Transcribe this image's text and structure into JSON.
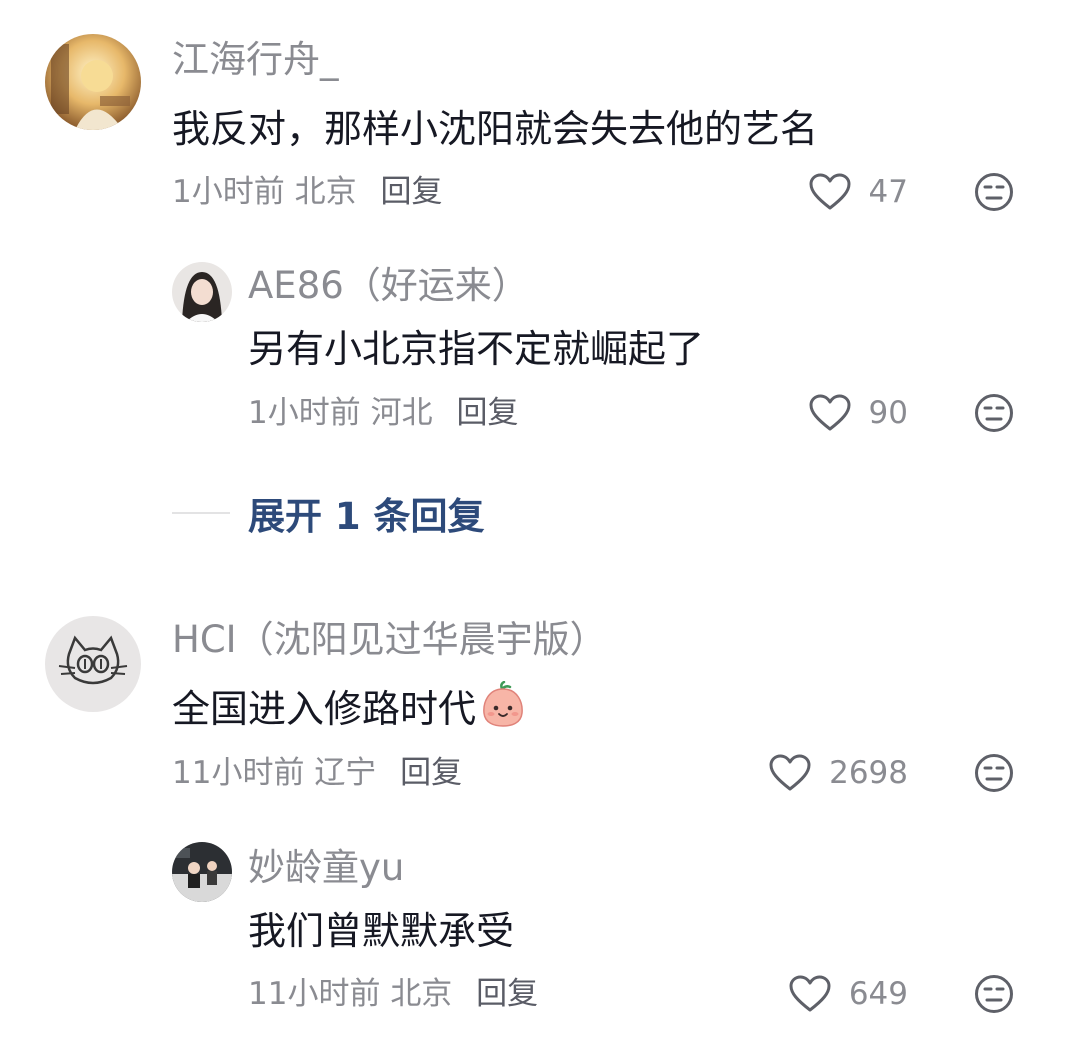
{
  "comments": [
    {
      "username": "江海行舟_",
      "text": "我反对，那样小沈阳就会失去他的艺名",
      "time": "1小时前",
      "location": "北京",
      "reply_label": "回复",
      "likes": "47",
      "replies": [
        {
          "username": "AE86（好运来）",
          "text": "另有小北京指不定就崛起了",
          "time": "1小时前",
          "location": "河北",
          "reply_label": "回复",
          "likes": "90"
        }
      ],
      "expand_label": "展开 1 条回复"
    },
    {
      "username": "HCI（沈阳见过华晨宇版）",
      "text": "全国进入修路时代",
      "text_emoji": "peach-face-emoji",
      "time": "11小时前",
      "location": "辽宁",
      "reply_label": "回复",
      "likes": "2698",
      "replies": [
        {
          "username": "妙龄童yu",
          "text": "我们曾默默承受",
          "time": "11小时前",
          "location": "北京",
          "reply_label": "回复",
          "likes": "649"
        }
      ]
    }
  ],
  "icons": {
    "like": "heart-outline-icon",
    "dislike": "neutral-face-icon"
  },
  "colors": {
    "text_primary": "#161823",
    "text_secondary": "#8a8b91",
    "link_blue": "#2d4a7a"
  }
}
